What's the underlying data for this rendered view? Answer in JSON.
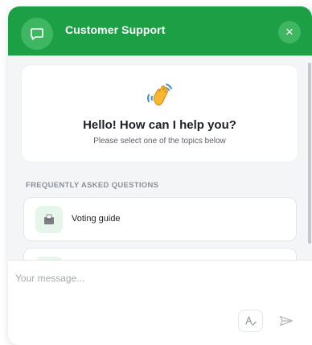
{
  "colors": {
    "brand": "#1d9f45",
    "brand_light": "#3fb662",
    "icon_tint": "#e6f6ea"
  },
  "header": {
    "title": "Customer Support",
    "avatar_icon": "chat-icon",
    "close_icon": "close-icon",
    "close_label": "×"
  },
  "greeting": {
    "icon": "waving-hand-icon",
    "title": "Hello! How can I help you?",
    "subtitle": "Please select one of the topics below"
  },
  "faq": {
    "heading": "FREQUENTLY ASKED QUESTIONS",
    "items": [
      {
        "icon": "ballot-box-icon",
        "label": "Voting guide"
      },
      {
        "icon": "topic-icon",
        "label": ""
      }
    ]
  },
  "composer": {
    "placeholder": "Your message...",
    "format_icon": "text-format-icon",
    "send_icon": "send-icon"
  }
}
